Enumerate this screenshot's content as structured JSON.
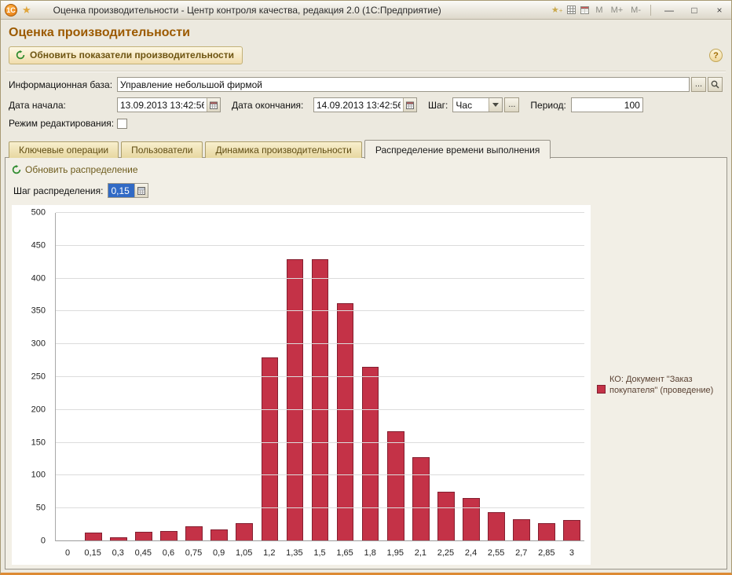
{
  "window": {
    "logo": "1С",
    "title": "Оценка производительности - Центр контроля качества, редакция 2.0  (1С:Предприятие)",
    "memory_buttons": [
      "M",
      "M+",
      "M-"
    ],
    "controls": {
      "minimize": "—",
      "maximize": "□",
      "close": "×"
    }
  },
  "page": {
    "title": "Оценка производительности",
    "refresh_button": "Обновить показатели производительности",
    "help_label": "?"
  },
  "form": {
    "infobase_label": "Информационная база:",
    "infobase_value": "Управление небольшой фирмой",
    "date_start_label": "Дата начала:",
    "date_start_value": "13.09.2013 13:42:56",
    "date_end_label": "Дата окончания:",
    "date_end_value": "14.09.2013 13:42:56",
    "step_label": "Шаг:",
    "step_value": "Час",
    "period_label": "Период:",
    "period_value": "100",
    "edit_mode_label": "Режим редактирования:"
  },
  "ui": {
    "ellipsis": "..."
  },
  "tabs": [
    {
      "label": "Ключевые операции",
      "active": false
    },
    {
      "label": "Пользователи",
      "active": false
    },
    {
      "label": "Динамика производительности",
      "active": false
    },
    {
      "label": "Распределение времени выполнения",
      "active": true
    }
  ],
  "distribution": {
    "refresh_link": "Обновить распределение",
    "step_label": "Шаг распределения:",
    "step_value": "0,15"
  },
  "chart_data": {
    "type": "bar",
    "title": "",
    "xlabel": "",
    "ylabel": "",
    "categories": [
      "0",
      "0,15",
      "0,3",
      "0,45",
      "0,6",
      "0,75",
      "0,9",
      "1,05",
      "1,2",
      "1,35",
      "1,5",
      "1,65",
      "1,8",
      "1,95",
      "2,1",
      "2,25",
      "2,4",
      "2,55",
      "2,7",
      "2,85",
      "3"
    ],
    "values": [
      0,
      13,
      6,
      14,
      16,
      23,
      18,
      28,
      280,
      430,
      430,
      363,
      265,
      167,
      128,
      75,
      66,
      44,
      33,
      28,
      32
    ],
    "ylim": [
      0,
      500
    ],
    "ytick_step": 50,
    "grid": true,
    "bar_color": "#c43247",
    "legend_position": "right",
    "legend": [
      "КО: Документ \"Заказ покупателя\" (проведение)"
    ]
  }
}
